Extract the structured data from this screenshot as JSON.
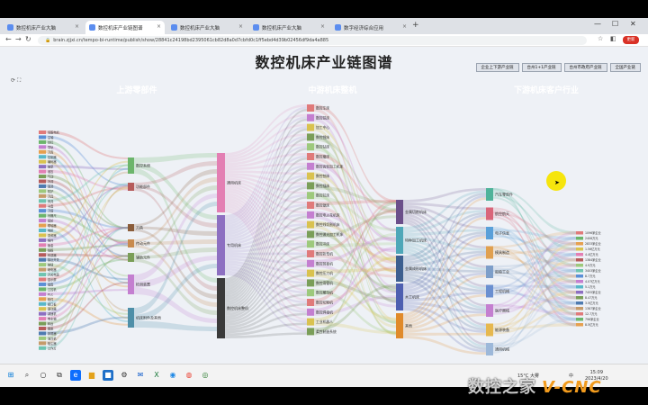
{
  "browser": {
    "tabs": [
      {
        "label": "数控机床产业大脑"
      },
      {
        "label": "数控机床产业链图谱"
      },
      {
        "label": "数控机床产业大脑"
      },
      {
        "label": "数控机床产业大脑"
      },
      {
        "label": "数字经济综合应用"
      }
    ],
    "active_tab": 1,
    "url": "brain.zjjxi.cn/tempo-bi-runtime/publish/show/28841c24198bd2395061cb82d8a0d7cbfd0c1ff5ebd4d39b02456df9da4a885",
    "profile_label": "更新"
  },
  "page": {
    "title": "数控机床产业链图谱",
    "nav_buttons": [
      "企业上下游产业链",
      "台州1+1产业链",
      "台州市政府产业链",
      "全国产业链"
    ],
    "categories": [
      {
        "label": "上游零部件",
        "color": "#e8a86a"
      },
      {
        "label": "中游机床整机",
        "color": "#8dbd79"
      },
      {
        "label": "下游机床客户行业",
        "color": "#3a8edb"
      }
    ]
  },
  "sankey": {
    "colors": [
      "#e07a7a",
      "#5a8fd6",
      "#6cb56b",
      "#c47fd0",
      "#e6a04f",
      "#58b8c9",
      "#d9c24f",
      "#8d6fc1",
      "#e37fb3",
      "#7a9e58",
      "#b65b5b",
      "#4e7bb0",
      "#9dc97c",
      "#c59b6a",
      "#6ec4b0"
    ],
    "col0_labels": [
      "伺服电机",
      "主轴",
      "丝杠",
      "导轨",
      "刀库",
      "控制器",
      "编码器",
      "轴承",
      "液压",
      "气动",
      "冷却",
      "润滑",
      "防护",
      "刀具",
      "夹具",
      "卡盘",
      "刀塔",
      "光栅尺",
      "齿轮",
      "联轴器",
      "电柜",
      "变频器",
      "铸件",
      "钣金",
      "线缆",
      "传感器",
      "接近开关",
      "按钮",
      "继电器",
      "开关电源",
      "显示屏",
      "键盘",
      "工控机",
      "PLC",
      "软件",
      "接口板",
      "驱动器",
      "减速机",
      "电主轴",
      "转台",
      "尾座",
      "排屑器",
      "油冷机",
      "吸尘器",
      "工作灯"
    ],
    "col1_nodes": [
      {
        "label": "数控系统",
        "color": "#6cb56b"
      },
      {
        "label": "功能部件",
        "color": "#b65b5b"
      },
      {
        "label": "刀具",
        "color": "#8a5c3a"
      },
      {
        "label": "传动元件",
        "color": "#c88a4e"
      },
      {
        "label": "辅助元件",
        "color": "#7a9e58"
      },
      {
        "label": "检测装置",
        "color": "#c47fd0"
      },
      {
        "label": "机床附件及其他",
        "color": "#4e8fa8"
      }
    ],
    "col2_nodes": [
      {
        "label": "通用机床",
        "color": "#e37fb3"
      },
      {
        "label": "专用机床",
        "color": "#8d6fc1"
      },
      {
        "label": "数控机床整机",
        "color": "#3a3a3a"
      }
    ],
    "col3_nodes": [
      "数控车床",
      "数控铣床",
      "加工中心",
      "数控镗床",
      "数控钻床",
      "数控磨床",
      "数控齿轮加工机床",
      "数控刨床",
      "数控插床",
      "数控拉床",
      "数控锯床",
      "数控电火花机床",
      "数控线切割机床",
      "数控激光加工机床",
      "数控冲床",
      "数控折弯机",
      "数控剪板机",
      "数控压力机",
      "数控弯管机",
      "数控雕刻机",
      "数控切割机",
      "数控焊接机",
      "工业机器人",
      "柔性制造系统"
    ],
    "col4_nodes": [
      {
        "label": "金属切削机床",
        "color": "#6b4e8a"
      },
      {
        "label": "特种加工机床",
        "color": "#4ea7b8"
      },
      {
        "label": "金属成形机床",
        "color": "#3d5f8f"
      },
      {
        "label": "木工机床",
        "color": "#4e5fb0"
      },
      {
        "label": "其他",
        "color": "#e08a2a"
      }
    ],
    "col5_nodes": [
      {
        "label": "汽车零部件",
        "color": "#4fb39a"
      },
      {
        "label": "航空航天",
        "color": "#d9667a"
      },
      {
        "label": "电子信息",
        "color": "#5aa0d9"
      },
      {
        "label": "模具制造",
        "color": "#e0a050"
      },
      {
        "label": "船舶工业",
        "color": "#7d9ec9"
      },
      {
        "label": "工程机械",
        "color": "#6a8fd0"
      },
      {
        "label": "医疗器械",
        "color": "#c47fd0"
      },
      {
        "label": "能源装备",
        "color": "#e6b84f"
      },
      {
        "label": "通用机械",
        "color": "#9db8d9"
      }
    ],
    "col6_labels": [
      "1096家企业",
      "2408万元",
      "2833家企业",
      "1.56亿万元",
      "4.4亿万元",
      "1384家企业",
      "4.9万元",
      "3403家企业",
      "8.7万元",
      "4.07亿万元",
      "5.1万元",
      "7455家企业",
      "8.47万元",
      "3.5亿万元",
      "1387家企业",
      "12.7万元",
      "796家企业",
      "8.5亿万元"
    ]
  },
  "taskbar": {
    "search_icon": "search-icon",
    "tray_text": "15°C 大雾",
    "lang": "中",
    "time": "15:09",
    "date": "2023/4/20"
  },
  "watermark": {
    "text_cn": "数控之家",
    "text_en": "V-CNC"
  }
}
